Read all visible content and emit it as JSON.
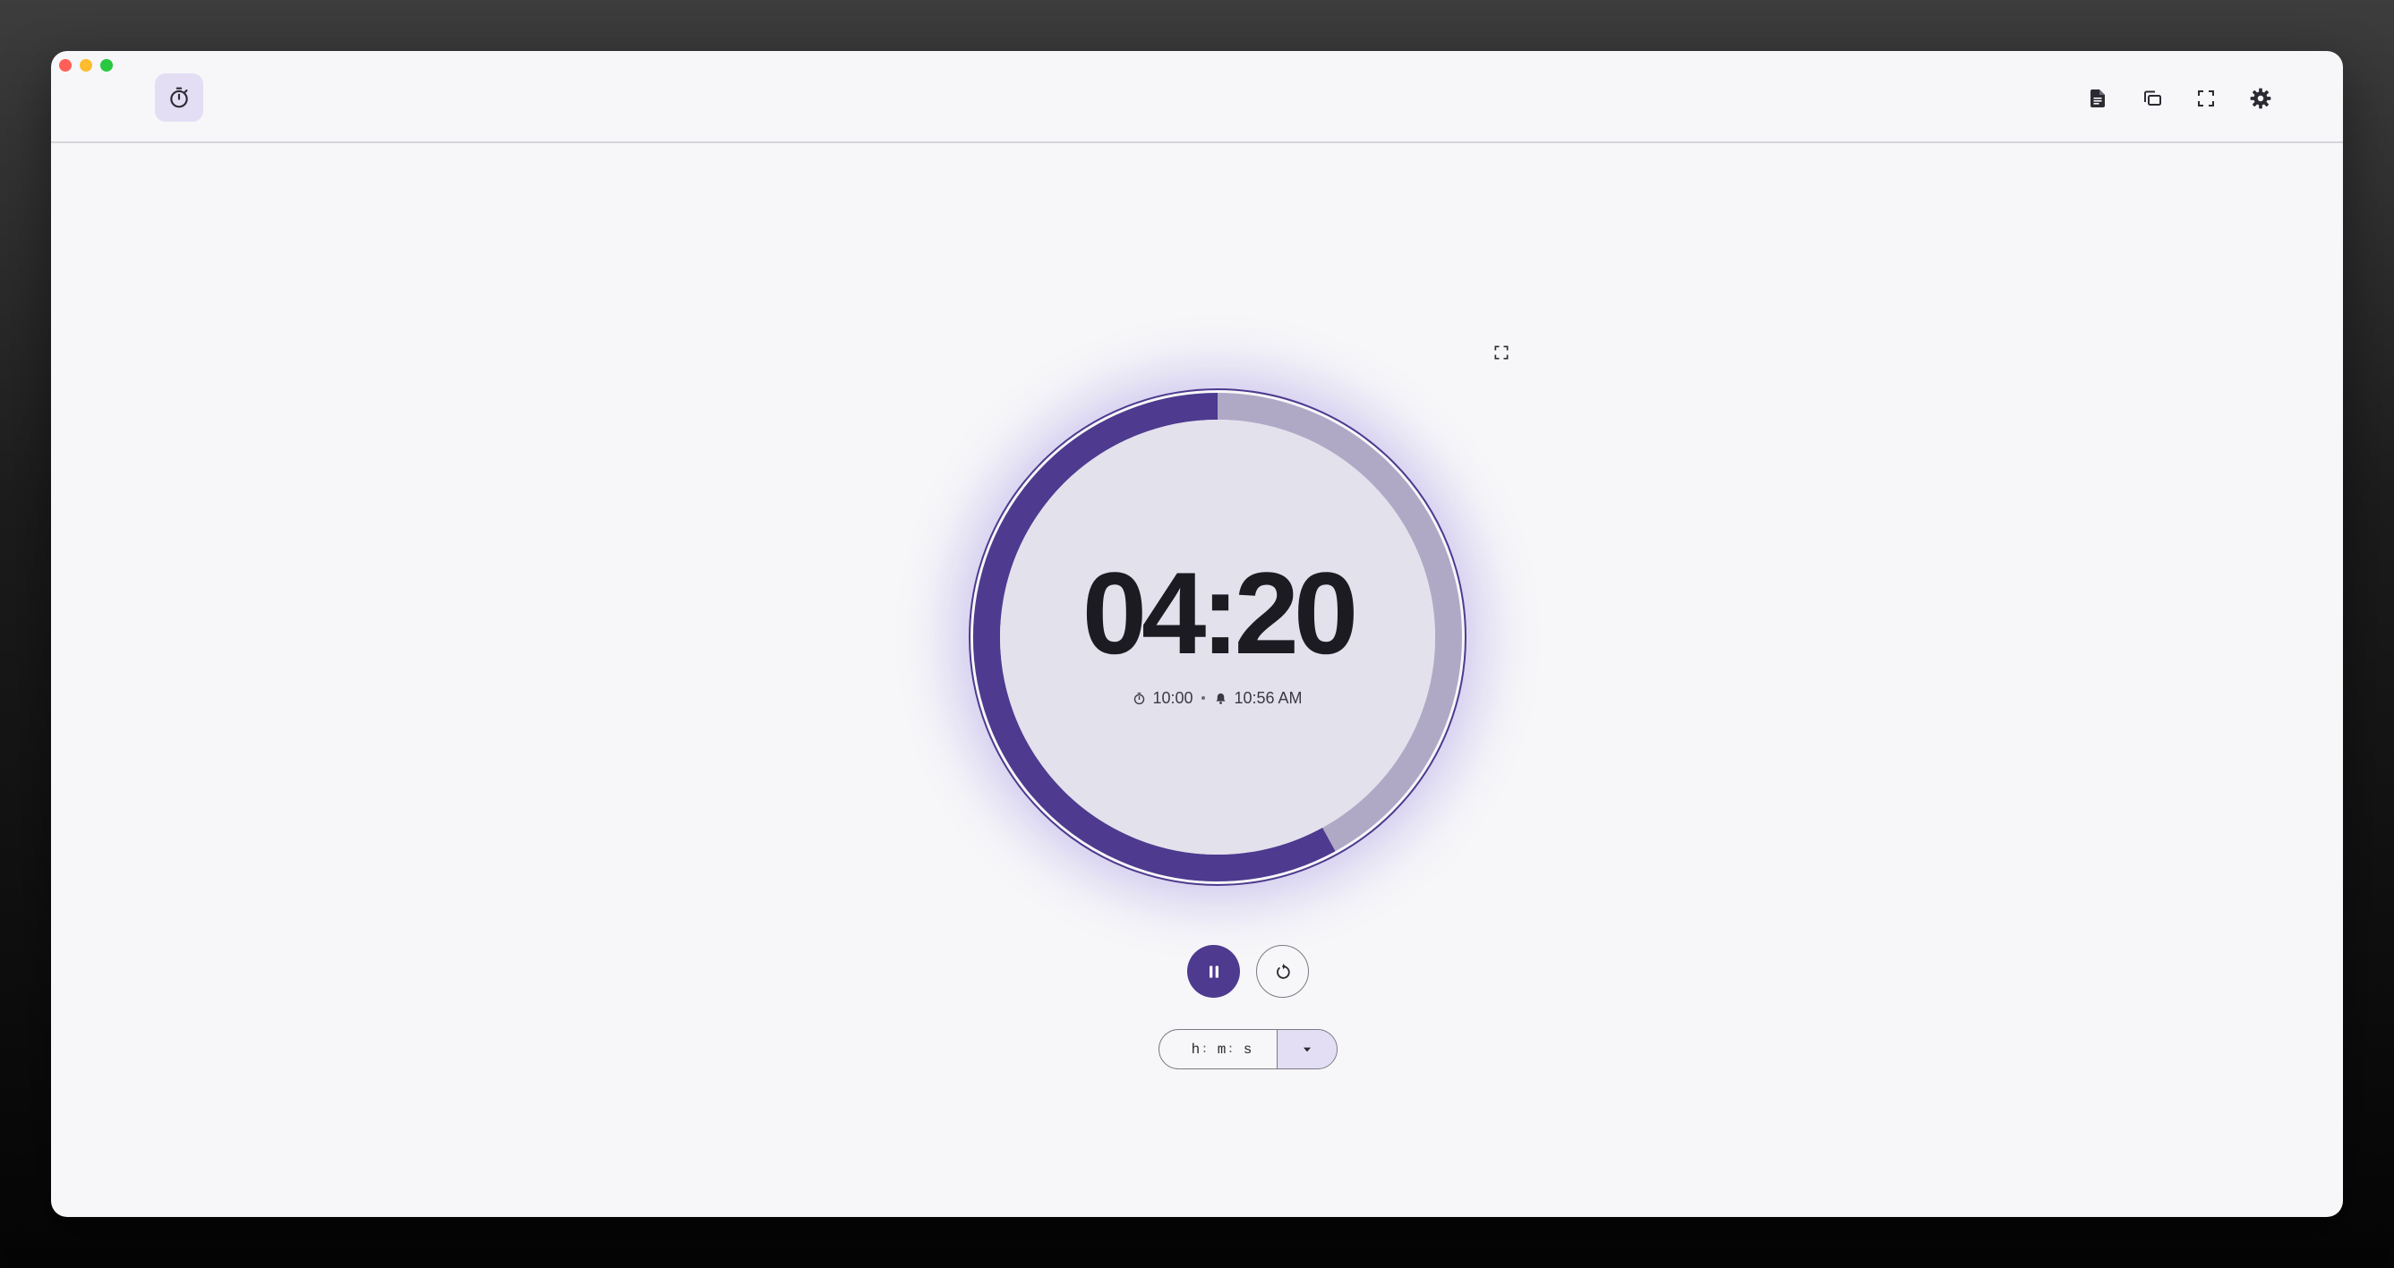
{
  "window": {
    "traffic_lights": [
      "close",
      "minimize",
      "maximize"
    ]
  },
  "toolbar": {
    "app_icon": "timer-icon",
    "actions": [
      {
        "name": "notes",
        "icon": "document-icon"
      },
      {
        "name": "picture-in-picture",
        "icon": "pip-icon"
      },
      {
        "name": "fullscreen",
        "icon": "expand-icon"
      },
      {
        "name": "settings",
        "icon": "gear-icon"
      }
    ]
  },
  "timer": {
    "remaining": "04:20",
    "duration": "10:00",
    "ends_at": "10:56 AM",
    "progress_elapsed_fraction": 0.58,
    "colors": {
      "accent": "#4e3a8f",
      "track": "#b0a9c6",
      "face": "#e3e1ec"
    }
  },
  "controls": {
    "pause_icon": "pause-icon",
    "reset_icon": "reset-icon"
  },
  "duration_input": {
    "hours_label": "h",
    "minutes_label": "m",
    "seconds_label": "s",
    "dropdown_icon": "caret-down-icon"
  }
}
